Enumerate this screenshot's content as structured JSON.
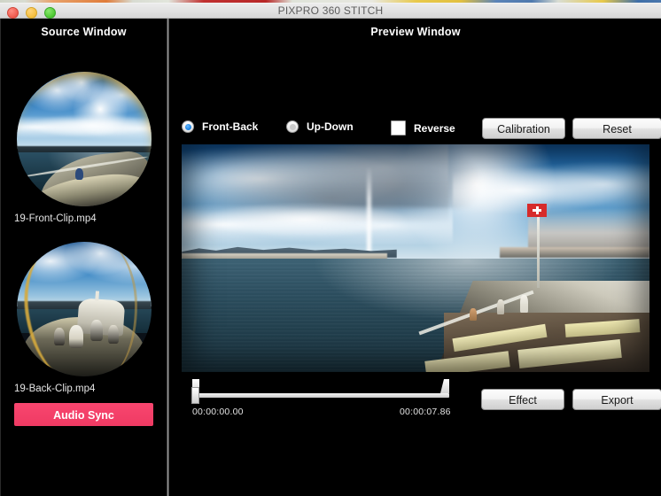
{
  "window": {
    "title": "PIXPRO 360 STITCH",
    "traffic_lights": [
      "close-button",
      "minimize-button",
      "maximize-button"
    ],
    "titlebar_bg": "#e4e4e4",
    "title_color": "#5c5c5c"
  },
  "source_panel": {
    "heading": "Source Window",
    "clips": [
      {
        "name": "19-Front-Clip.mp4",
        "thumbnail": "fisheye-front-preview"
      },
      {
        "name": "19-Back-Clip.mp4",
        "thumbnail": "fisheye-back-preview"
      }
    ],
    "audio_sync_label": "Audio Sync",
    "audio_sync_color": "#f4406a"
  },
  "preview_panel": {
    "heading": "Preview Window",
    "controls": {
      "mode_options": [
        {
          "label": "Front-Back",
          "selected": true
        },
        {
          "label": "Up-Down",
          "selected": false
        }
      ],
      "reverse": {
        "label": "Reverse",
        "checked": false
      },
      "calibration_label": "Calibration",
      "reset_label": "Reset"
    },
    "video": {
      "description": "panoramic-stitched-lake-geneva-boat-deck"
    },
    "timeline": {
      "start_time": "00:00:00.00",
      "end_time": "00:00:07.86",
      "playhead_position_percent": 0
    },
    "actions": {
      "effect_label": "Effect",
      "export_label": "Export"
    }
  }
}
